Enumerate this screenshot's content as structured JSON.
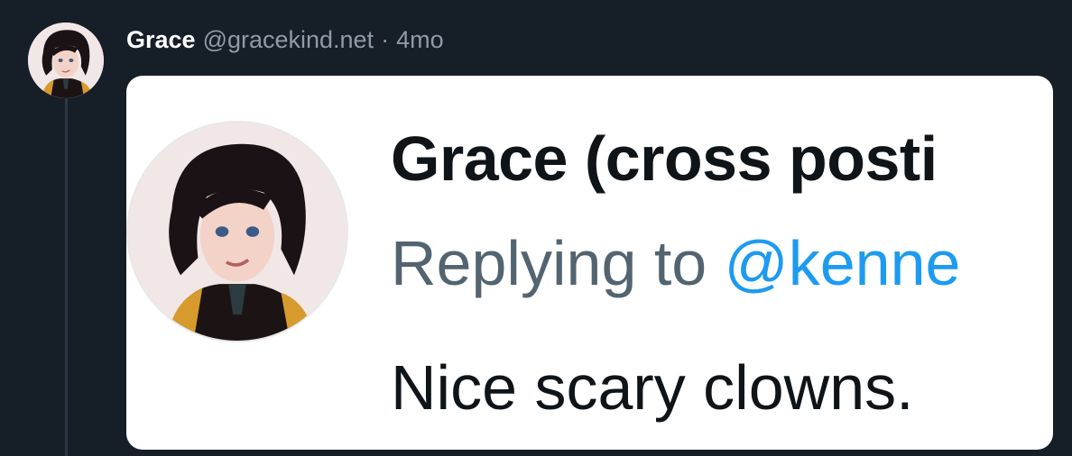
{
  "post": {
    "display_name": "Grace",
    "handle": "@gracekind.net",
    "separator": "·",
    "time": "4mo"
  },
  "embed": {
    "name": "Grace (cross posti",
    "replying_prefix": "Replying to ",
    "replying_handle": "@kenne",
    "body": "Nice scary clowns."
  },
  "icons": {
    "author_avatar": "avatar-illustration",
    "embed_avatar": "avatar-illustration"
  },
  "colors": {
    "background": "#161e27",
    "name": "#ffffff",
    "muted": "#8f9ba9",
    "link": "#1d9bf0",
    "reply_text": "#536471"
  }
}
